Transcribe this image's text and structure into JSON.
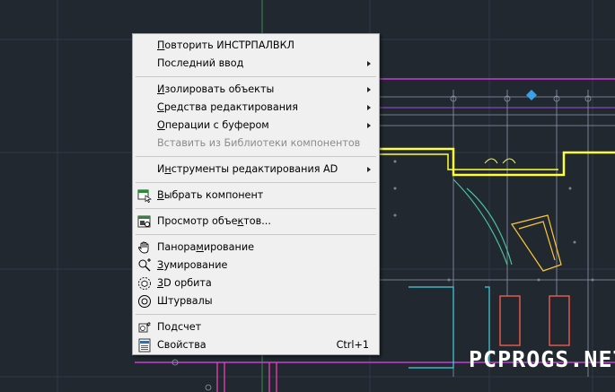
{
  "menu": {
    "items": [
      {
        "pre": "",
        "u": "П",
        "post": "овторить ИНСТРПАЛВКЛ",
        "submenu": false,
        "disabled": false,
        "icon": ""
      },
      {
        "pre": "Последний ввод",
        "u": "",
        "post": "",
        "submenu": true,
        "disabled": false,
        "icon": ""
      },
      {
        "pre": "",
        "u": "И",
        "post": "золировать объекты",
        "submenu": true,
        "disabled": false,
        "icon": ""
      },
      {
        "pre": "",
        "u": "С",
        "post": "редства редактирования",
        "submenu": true,
        "disabled": false,
        "icon": ""
      },
      {
        "pre": "",
        "u": "О",
        "post": "перации с буфером",
        "submenu": true,
        "disabled": false,
        "icon": ""
      },
      {
        "pre": "Вставить из Библиотеки компонентов",
        "u": "",
        "post": "",
        "submenu": false,
        "disabled": true,
        "icon": ""
      },
      {
        "pre": "И",
        "u": "н",
        "post": "струменты редактирования AD",
        "submenu": true,
        "disabled": false,
        "icon": ""
      },
      {
        "pre": "",
        "u": "В",
        "post": "ыбрать компонент",
        "submenu": false,
        "disabled": false,
        "icon": "select-component-icon"
      },
      {
        "pre": "Просмотр объе",
        "u": "к",
        "post": "тов...",
        "submenu": false,
        "disabled": false,
        "icon": "object-viewer-icon"
      },
      {
        "pre": "Панора",
        "u": "м",
        "post": "ирование",
        "submenu": false,
        "disabled": false,
        "icon": "pan-hand-icon"
      },
      {
        "pre": "",
        "u": "З",
        "post": "умирование",
        "submenu": false,
        "disabled": false,
        "icon": "zoom-icon"
      },
      {
        "pre": "",
        "u": "3",
        "post": "D орбита",
        "submenu": false,
        "disabled": false,
        "icon": "orbit-3d-icon"
      },
      {
        "pre": "Штурвалы",
        "u": "",
        "post": "",
        "submenu": false,
        "disabled": false,
        "icon": "steering-wheel-icon"
      },
      {
        "pre": "Подсчет",
        "u": "",
        "post": "",
        "submenu": false,
        "disabled": false,
        "icon": "count-icon"
      },
      {
        "pre": "Свойства",
        "u": "",
        "post": "",
        "submenu": false,
        "disabled": false,
        "icon": "properties-icon",
        "shortcut": "Ctrl+1"
      }
    ]
  },
  "watermark": "PCPROGS.NET"
}
